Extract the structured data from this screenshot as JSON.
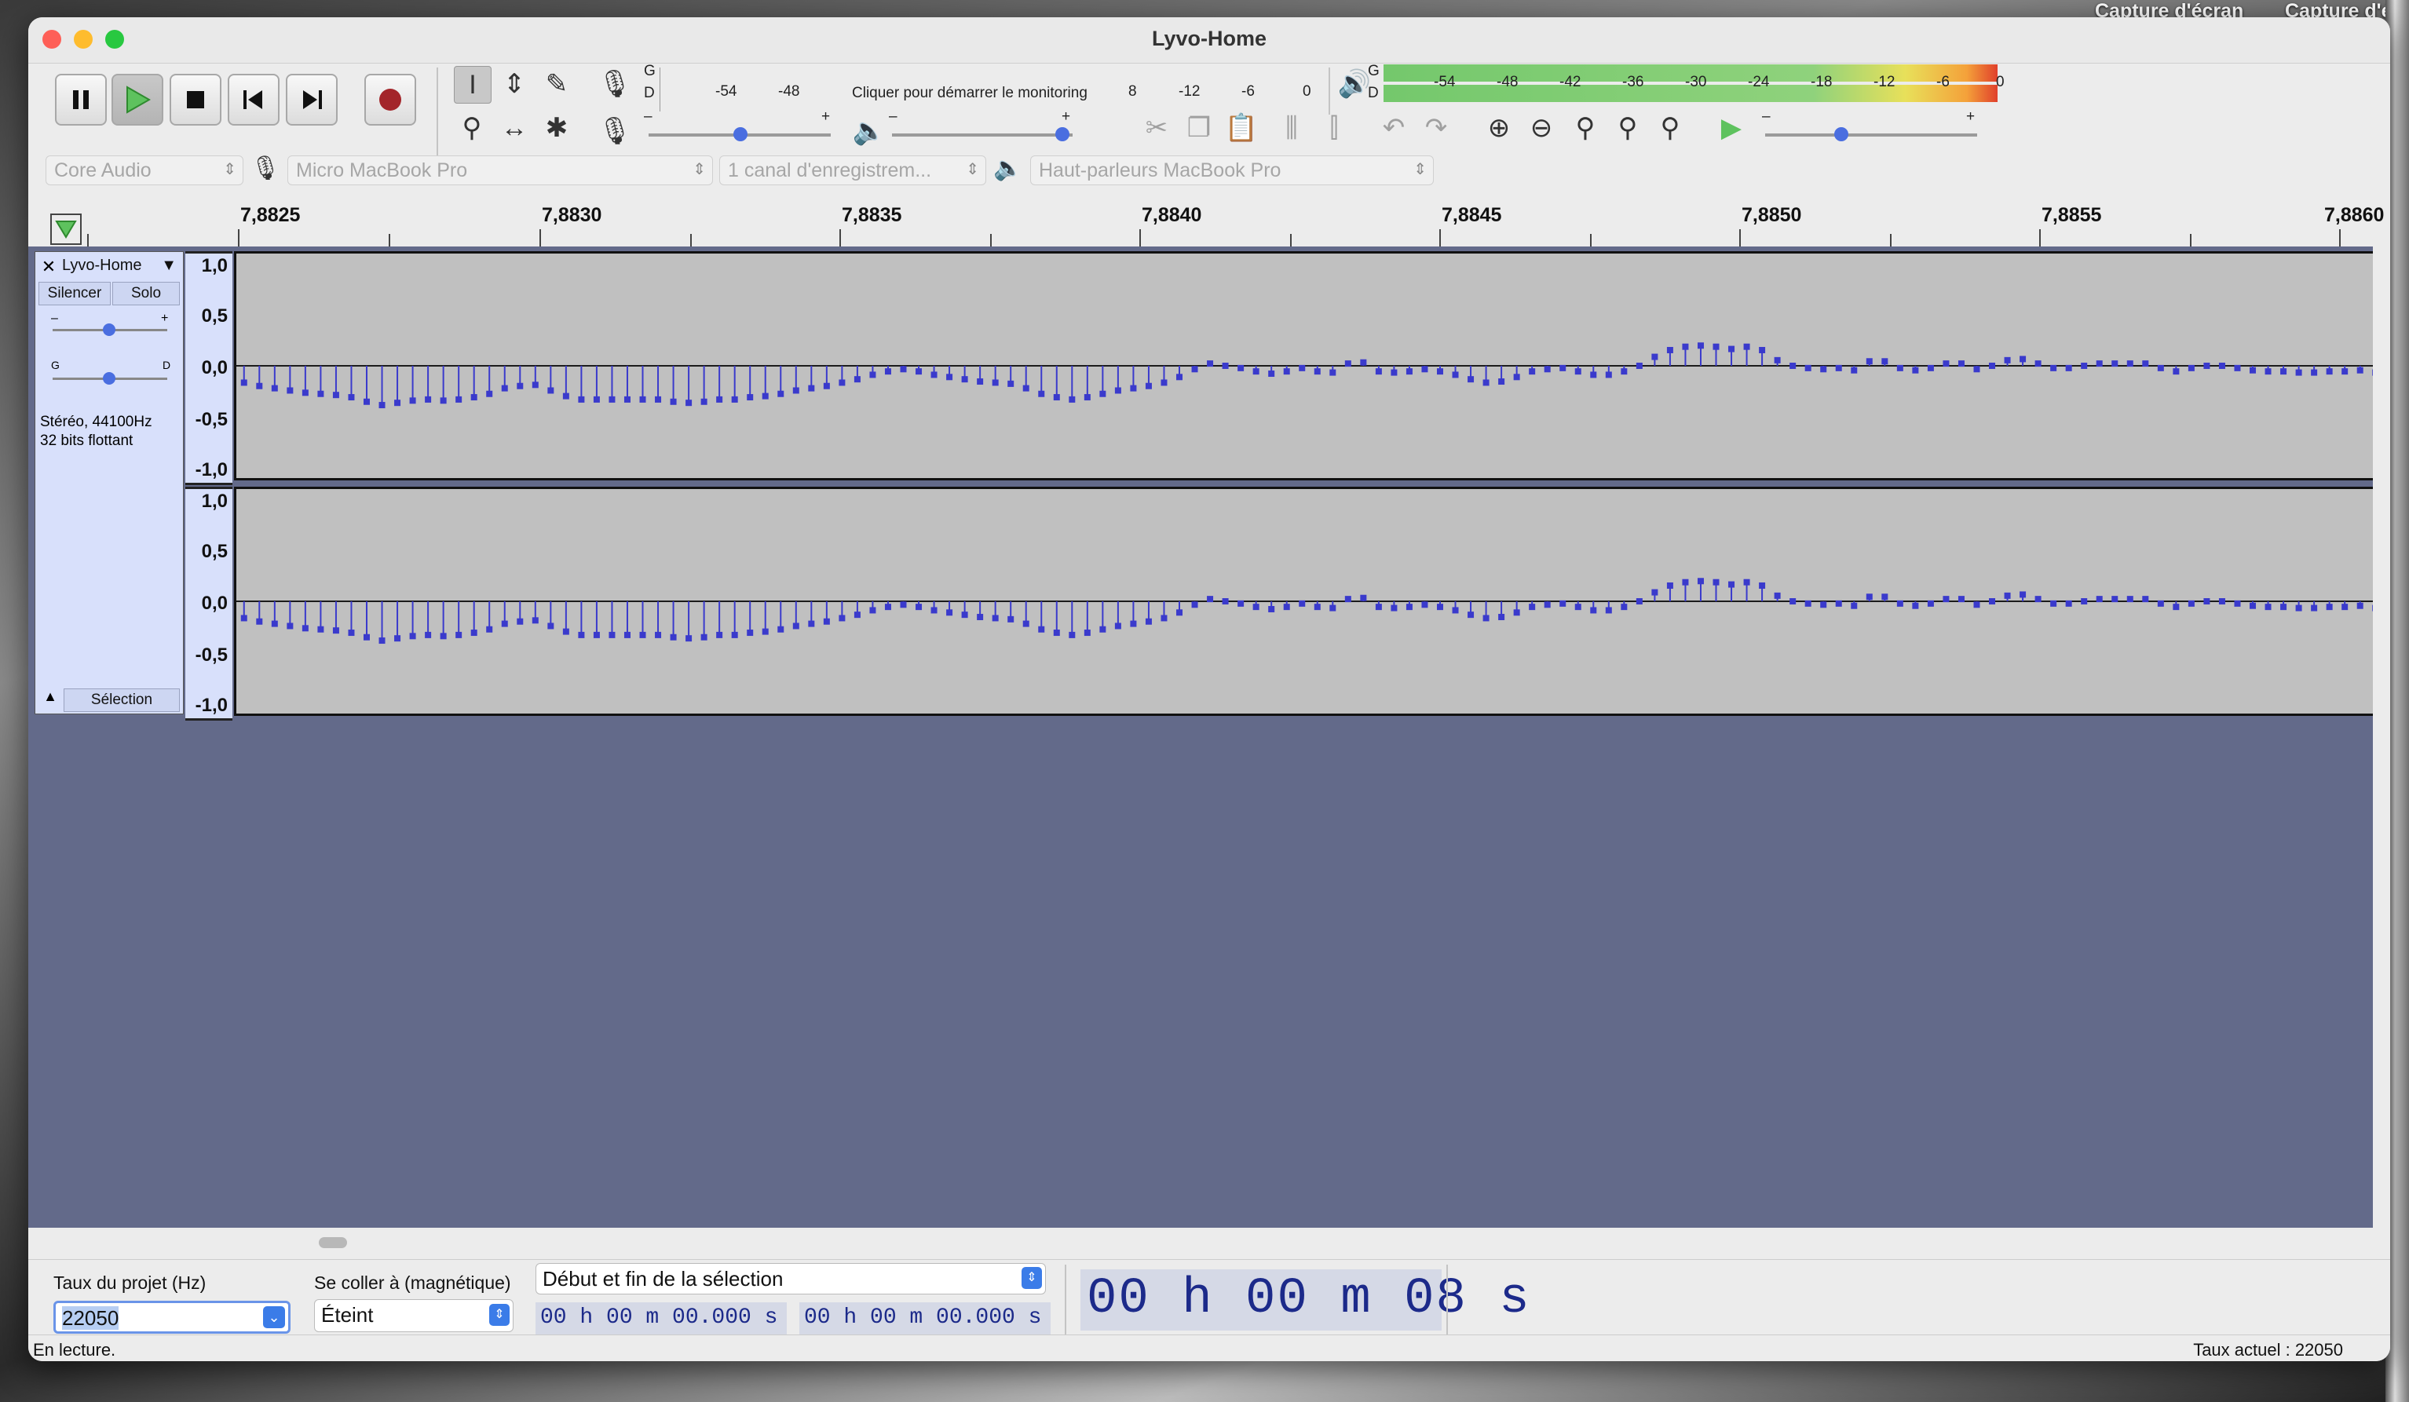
{
  "desktop": {
    "labels": [
      "Capture d'écran",
      "Capture d'éc"
    ]
  },
  "window": {
    "title": "Lyvo-Home"
  },
  "meters": {
    "rec_channels": [
      "G",
      "D"
    ],
    "rec_ticks": [
      "-54",
      "-48",
      "8",
      "-12",
      "-6",
      "0"
    ],
    "rec_prompt": "Cliquer pour démarrer le monitoring",
    "play_channels": [
      "G",
      "D"
    ],
    "play_ticks": [
      "-54",
      "-48",
      "-42",
      "-36",
      "-30",
      "-24",
      "-18",
      "-12",
      "-6",
      "0"
    ]
  },
  "sliders": {
    "rec_volume": {
      "min": "–",
      "max": "+"
    },
    "play_volume": {
      "min": "–",
      "max": "+"
    },
    "play_speed": {
      "min": "–",
      "max": "+"
    }
  },
  "devices": {
    "host": "Core Audio",
    "recording_device": "Micro MacBook Pro",
    "channels": "1 canal d'enregistrem...",
    "playback_device": "Haut-parleurs MacBook Pro"
  },
  "ruler": {
    "labels": [
      "7,8825",
      "7,8830",
      "7,8835",
      "7,8840",
      "7,8845",
      "7,8850",
      "7,8855",
      "7,8860"
    ]
  },
  "track": {
    "name": "Lyvo-Home",
    "mute_label": "Silencer",
    "solo_label": "Solo",
    "gain_min": "–",
    "gain_max": "+",
    "pan_left": "G",
    "pan_right": "D",
    "info_line1": "Stéréo, 44100Hz",
    "info_line2": "32 bits flottant",
    "select_label": "Sélection",
    "scale_labels": [
      "1,0",
      "0,5",
      "0,0",
      "-0,5",
      "-1,0"
    ]
  },
  "chart_data": {
    "type": "scatter",
    "description": "stem/lollipop sample plot, two channels",
    "x_range": [
      7.8821,
      7.886
    ],
    "ylim": [
      -1.0,
      1.0
    ],
    "color": "#3a3acc",
    "channels": [
      {
        "name": "left",
        "samples": [
          -0.15,
          -0.18,
          -0.2,
          -0.22,
          -0.24,
          -0.25,
          -0.26,
          -0.28,
          -0.32,
          -0.35,
          -0.33,
          -0.31,
          -0.3,
          -0.31,
          -0.3,
          -0.28,
          -0.25,
          -0.2,
          -0.18,
          -0.17,
          -0.22,
          -0.27,
          -0.3,
          -0.3,
          -0.3,
          -0.3,
          -0.3,
          -0.3,
          -0.32,
          -0.33,
          -0.32,
          -0.3,
          -0.3,
          -0.28,
          -0.27,
          -0.25,
          -0.22,
          -0.2,
          -0.18,
          -0.15,
          -0.12,
          -0.08,
          -0.05,
          -0.03,
          -0.05,
          -0.08,
          -0.1,
          -0.12,
          -0.14,
          -0.15,
          -0.16,
          -0.2,
          -0.25,
          -0.28,
          -0.3,
          -0.28,
          -0.25,
          -0.22,
          -0.2,
          -0.18,
          -0.15,
          -0.1,
          -0.03,
          0.02,
          0.0,
          -0.02,
          -0.05,
          -0.07,
          -0.05,
          -0.02,
          -0.05,
          -0.06,
          0.02,
          0.03,
          -0.05,
          -0.06,
          -0.05,
          -0.03,
          -0.05,
          -0.08,
          -0.12,
          -0.15,
          -0.14,
          -0.1,
          -0.05,
          -0.03,
          -0.02,
          -0.05,
          -0.08,
          -0.08,
          -0.05,
          0.0,
          0.08,
          0.14,
          0.17,
          0.18,
          0.17,
          0.15,
          0.17,
          0.14,
          0.05,
          0.0,
          -0.02,
          -0.03,
          -0.02,
          -0.04,
          0.04,
          0.04,
          -0.02,
          -0.04,
          -0.02,
          0.02,
          0.02,
          -0.03,
          0.0,
          0.05,
          0.06,
          0.02,
          -0.02,
          -0.02,
          0.0,
          0.02,
          0.02,
          0.02,
          0.02,
          -0.02,
          -0.05,
          -0.02,
          0.0,
          0.0,
          -0.02,
          -0.04,
          -0.05,
          -0.05,
          -0.06,
          -0.06,
          -0.05,
          -0.05,
          -0.04,
          -0.06
        ]
      },
      {
        "name": "right",
        "samples": [
          -0.15,
          -0.18,
          -0.2,
          -0.22,
          -0.24,
          -0.25,
          -0.26,
          -0.28,
          -0.32,
          -0.35,
          -0.33,
          -0.31,
          -0.3,
          -0.31,
          -0.3,
          -0.28,
          -0.25,
          -0.2,
          -0.18,
          -0.17,
          -0.22,
          -0.27,
          -0.3,
          -0.3,
          -0.3,
          -0.3,
          -0.3,
          -0.3,
          -0.32,
          -0.33,
          -0.32,
          -0.3,
          -0.3,
          -0.28,
          -0.27,
          -0.25,
          -0.22,
          -0.2,
          -0.18,
          -0.15,
          -0.12,
          -0.08,
          -0.05,
          -0.03,
          -0.05,
          -0.08,
          -0.1,
          -0.12,
          -0.14,
          -0.15,
          -0.16,
          -0.2,
          -0.25,
          -0.28,
          -0.3,
          -0.28,
          -0.25,
          -0.22,
          -0.2,
          -0.18,
          -0.15,
          -0.1,
          -0.03,
          0.02,
          0.0,
          -0.02,
          -0.05,
          -0.07,
          -0.05,
          -0.02,
          -0.05,
          -0.06,
          0.02,
          0.03,
          -0.05,
          -0.06,
          -0.05,
          -0.03,
          -0.05,
          -0.08,
          -0.12,
          -0.15,
          -0.14,
          -0.1,
          -0.05,
          -0.03,
          -0.02,
          -0.05,
          -0.08,
          -0.08,
          -0.05,
          0.0,
          0.08,
          0.14,
          0.17,
          0.18,
          0.17,
          0.15,
          0.17,
          0.14,
          0.05,
          0.0,
          -0.02,
          -0.03,
          -0.02,
          -0.04,
          0.04,
          0.04,
          -0.02,
          -0.04,
          -0.02,
          0.02,
          0.02,
          -0.03,
          0.0,
          0.05,
          0.06,
          0.02,
          -0.02,
          -0.02,
          0.0,
          0.02,
          0.02,
          0.02,
          0.02,
          -0.02,
          -0.05,
          -0.02,
          0.0,
          0.0,
          -0.02,
          -0.04,
          -0.05,
          -0.05,
          -0.06,
          -0.06,
          -0.05,
          -0.05,
          -0.04,
          -0.06
        ]
      }
    ]
  },
  "bottom": {
    "rate_label": "Taux du projet (Hz)",
    "rate_value": "22050",
    "snap_label": "Se coller à (magnétique)",
    "snap_value": "Éteint",
    "selection_mode": "Début et fin de la sélection",
    "sel_start": "00 h 00 m 00.000 s",
    "sel_end": "00 h 00 m 00.000 s",
    "position": "00 h 00 m 08 s"
  },
  "status": {
    "left": "En lecture.",
    "right": "Taux actuel : 22050"
  }
}
